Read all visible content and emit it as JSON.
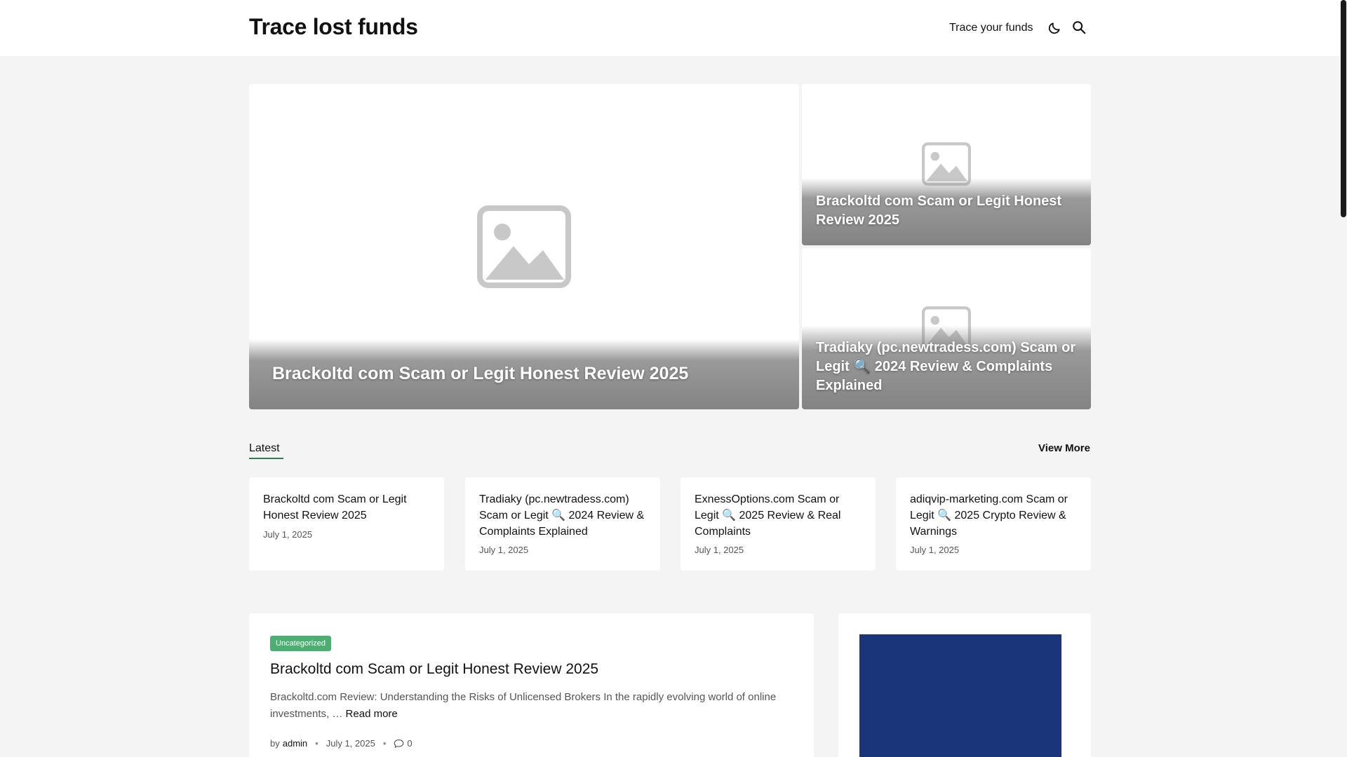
{
  "header": {
    "site_title": "Trace lost funds",
    "nav_link": "Trace your funds",
    "icons": [
      "moon-icon",
      "search-icon"
    ]
  },
  "featured": {
    "main": {
      "title": "Brackoltd com Scam or Legit Honest Review 2025"
    },
    "side": [
      {
        "title": "Brackoltd com Scam or Legit Honest Review 2025"
      },
      {
        "title": "Tradiaky (pc.newtradess.com) Scam or Legit 🔍 2024 Review & Complaints Explained"
      }
    ]
  },
  "latest": {
    "label": "Latest",
    "view_more": "View More",
    "items": [
      {
        "title": "Brackoltd com Scam or Legit Honest Review 2025",
        "date": "July 1, 2025"
      },
      {
        "title": "Tradiaky (pc.newtradess.com) Scam or Legit 🔍 2024 Review & Complaints Explained",
        "date": "July 1, 2025"
      },
      {
        "title": "ExnessOptions.com Scam or Legit 🔍 2025 Review & Real Complaints",
        "date": "July 1, 2025"
      },
      {
        "title": "adiqvip-marketing.com Scam or Legit 🔍 2025 Crypto Review & Warnings",
        "date": "July 1, 2025"
      }
    ]
  },
  "post": {
    "category": "Uncategorized",
    "title": "Brackoltd com Scam or Legit Honest Review 2025",
    "excerpt": "Brackoltd.com Review: Understanding the Risks of Unlicensed Brokers In the rapidly evolving world of online investments, …",
    "read_more": "Read more",
    "by": "by",
    "author": "admin",
    "date": "July 1, 2025",
    "comments": "0"
  },
  "colors": {
    "accent_green": "#4caf72",
    "underline_green": "#2e7d5b",
    "sidebar_block": "#1a3579",
    "background": "#f4f4f4"
  }
}
